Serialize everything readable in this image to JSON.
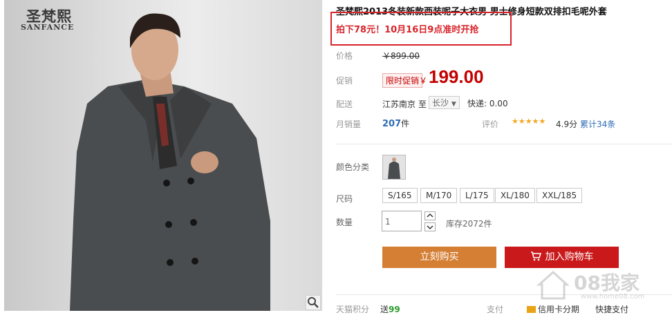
{
  "image": {
    "brand_cn": "圣梵熙",
    "brand_en": "SANFANCE"
  },
  "product": {
    "title": "圣梵熙2013冬装新款西装呢子大衣男 男士修身短款双排扣毛呢外套",
    "promo": "拍下78元！10月16日9点准时开抢",
    "price_label": "价格",
    "original_price": "￥899.00",
    "promo_label": "促销",
    "promo_tag": "限时促销",
    "currency": "￥",
    "sale_price": "199.00",
    "delivery_label": "配送",
    "from": "江苏南京",
    "to_word": "至",
    "destination": "长沙",
    "shipping": "快递: 0.00",
    "sales_label": "月销量",
    "sales_count": "207",
    "sales_unit": "件",
    "rating_label": "评价",
    "stars": "★★★★★",
    "rating_score": "4.9分",
    "review_count": "累计34条",
    "color_label": "颜色分类",
    "size_label": "尺码",
    "sizes": [
      "S/165",
      "M/170",
      "L/175",
      "XL/180",
      "XXL/185"
    ],
    "qty_label": "数量",
    "qty_value": "1",
    "stock": "库存2072件",
    "buy_now": "立刻购买",
    "add_to_cart": "加入购物车",
    "points_label": "天猫积分",
    "points_prefix": "送",
    "points_value": "99",
    "pay_label": "支付",
    "pay_credit": "信用卡分期",
    "pay_express": "快捷支付"
  },
  "watermark": {
    "text": "08我家",
    "url": "www.home08.com"
  },
  "colors": {
    "accent_red": "#c40000",
    "buy_orange": "#d47f34",
    "cart_red": "#c9191b",
    "promo_red": "#d8232a",
    "star_orange": "#f5a623"
  }
}
